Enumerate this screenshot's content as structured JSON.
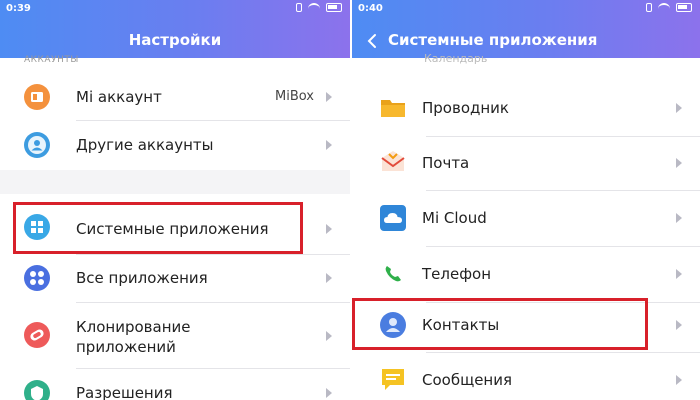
{
  "left": {
    "status": {
      "time": "0:39"
    },
    "title": "Настройки",
    "cut_label": "АККАУНТЫ",
    "items": [
      {
        "label": "Mi аккаунт",
        "value": "MiBox",
        "icon": "mi-account-icon",
        "color": "#f4913d"
      },
      {
        "label": "Другие аккаунты",
        "icon": "other-accounts-icon",
        "color": "#3d9ce0"
      },
      {
        "label": "Системные приложения",
        "icon": "system-apps-icon",
        "color": "#39a8e6"
      },
      {
        "label": "Все приложения",
        "icon": "all-apps-icon",
        "color": "#4a6fe0"
      },
      {
        "label_line1": "Клонирование",
        "label_line2": "приложений",
        "icon": "clone-apps-icon",
        "color": "#ee5a5a"
      },
      {
        "label": "Разрешения",
        "icon": "permissions-icon",
        "color": "#2fb08a"
      }
    ]
  },
  "right": {
    "status": {
      "time": "0:40"
    },
    "title": "Системные приложения",
    "cut_label": "Календарь",
    "items": [
      {
        "label": "Проводник",
        "icon": "folder-icon",
        "color": "#f7b82e"
      },
      {
        "label": "Почта",
        "icon": "mail-icon",
        "color": "#e24b3b"
      },
      {
        "label": "Mi Cloud",
        "icon": "cloud-icon",
        "color": "#2f86d8"
      },
      {
        "label": "Телефон",
        "icon": "phone-icon",
        "color": "#2fb04a"
      },
      {
        "label": "Контакты",
        "icon": "contacts-icon",
        "color": "#4a7de0"
      },
      {
        "label": "Сообщения",
        "icon": "messages-icon",
        "color": "#f5c323"
      }
    ]
  },
  "highlight_color": "#d8202a"
}
